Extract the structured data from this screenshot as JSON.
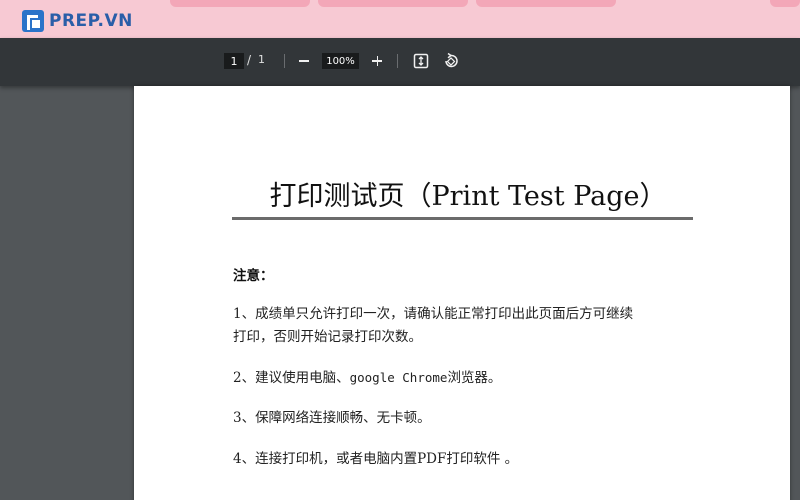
{
  "browser": {
    "brand_name": "PREP.VN"
  },
  "toolbar": {
    "current_page": "1",
    "page_separator": "/",
    "total_pages": "1",
    "zoom_level": "100%"
  },
  "document": {
    "title": "打印测试页（Print Test Page）",
    "note_label": "注意：",
    "items": [
      {
        "line1": "1、成绩单只允许打印一次，请确认能正常打印出此页面后方可继续",
        "line2": "打印，否则开始记录打印次数。"
      },
      {
        "prefix": "2、建议使用电脑、",
        "mono": "google Chrome",
        "suffix": "浏览器。"
      },
      {
        "line1": "3、保障网络连接顺畅、无卡顿。"
      },
      {
        "line1": "4、连接打印机，或者电脑内置PDF打印软件 。"
      }
    ]
  },
  "colors": {
    "tab_strip": "#f7c9d3",
    "toolbar": "#323639",
    "viewer_background": "#525659",
    "brand": "#2a5ea8"
  }
}
